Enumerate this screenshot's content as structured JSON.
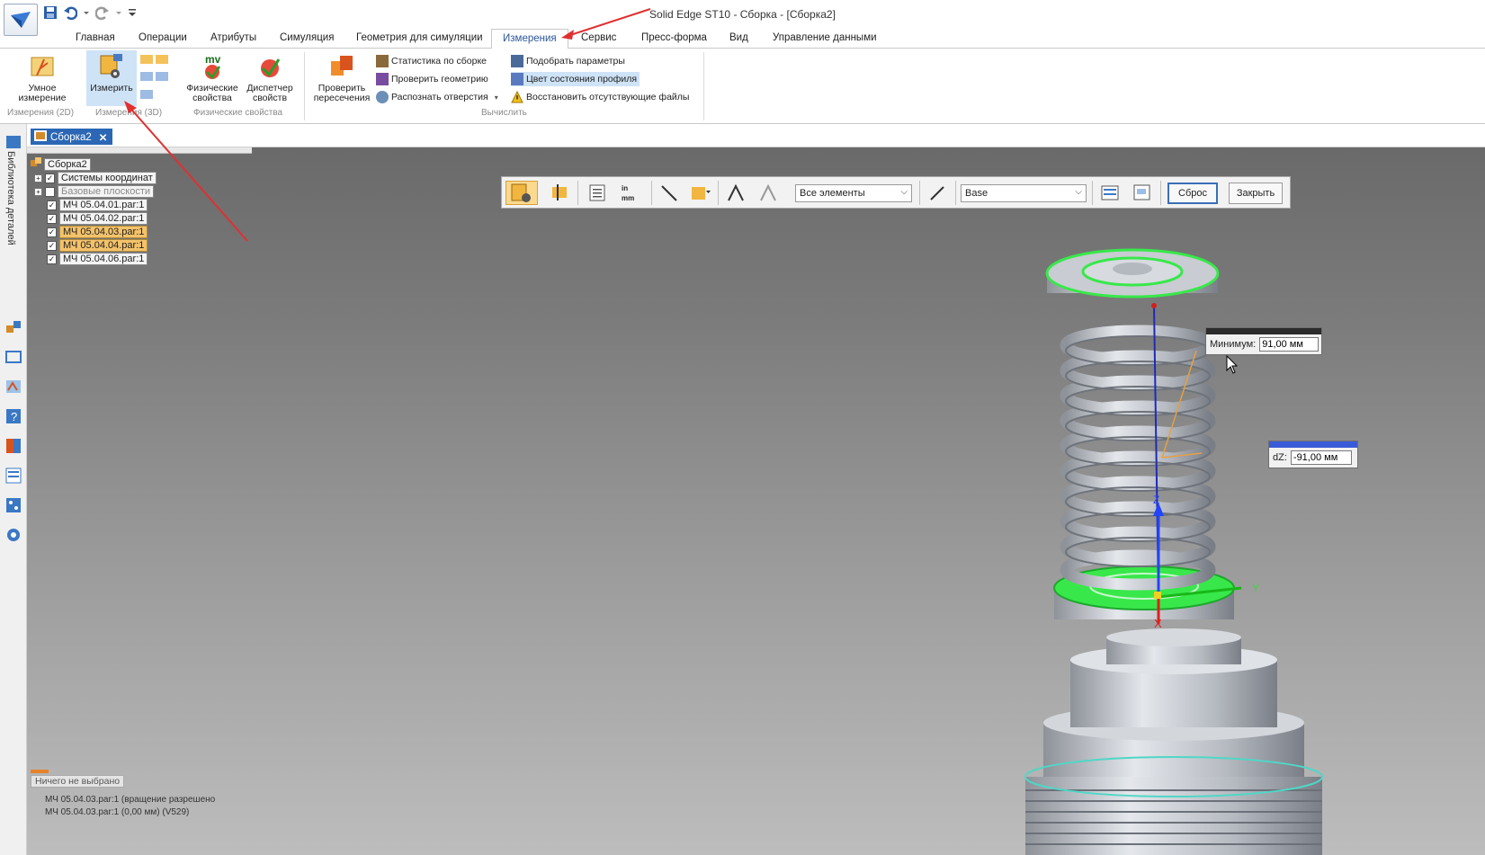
{
  "app": {
    "title": "Solid Edge ST10 - Сборка - [Сборка2]"
  },
  "tabs": [
    "Главная",
    "Операции",
    "Атрибуты",
    "Симуляция",
    "Геометрия для симуляции",
    "Измерения",
    "Сервис",
    "Пресс-форма",
    "Вид",
    "Управление данными"
  ],
  "active_tab": "Измерения",
  "ribbon": {
    "smart_measure": "Умное измерение",
    "measure": "Измерить",
    "physical_props": "Физические свойства",
    "prop_manager": "Диспетчер свойств",
    "check_interference": "Проверить пересечения",
    "assembly_stats": "Статистика по сборке",
    "check_geometry": "Проверить геометрию",
    "recognize_holes": "Распознать отверстия",
    "fit_params": "Подобрать параметры",
    "profile_color": "Цвет состояния профиля",
    "restore_files": "Восстановить отсутствующие файлы",
    "groups": {
      "measure2d": "Измерения (2D)",
      "measure3d": "Измерения (3D)",
      "physical": "Физические свойства",
      "compute": "Вычислить"
    },
    "mv_glyph": "mv"
  },
  "sidebar": {
    "library_label": "Библиотека деталей"
  },
  "document": {
    "tab_label": "Сборка2"
  },
  "tree": {
    "root": "Сборка2",
    "coord_systems": "Системы координат",
    "base_planes": "Базовые плоскости",
    "parts": [
      {
        "label": "МЧ 05.04.01.par:1",
        "selected": false
      },
      {
        "label": "МЧ 05.04.02.par:1",
        "selected": false
      },
      {
        "label": "МЧ 05.04.03.par:1",
        "selected": true
      },
      {
        "label": "МЧ 05.04.04.par:1",
        "selected": true
      },
      {
        "label": "МЧ 05.04.06.par:1",
        "selected": false
      }
    ]
  },
  "measure_bar": {
    "filter": "Все элементы",
    "coord": "Base",
    "reset": "Сброс",
    "close": "Закрыть",
    "units_glyph": "in mm"
  },
  "measurement": {
    "min_label": "Минимум:",
    "min_value": "91,00 мм",
    "dz_label": "dZ:",
    "dz_value": "-91,00 мм"
  },
  "axes": {
    "x": "X",
    "y": "Y",
    "z": "Z"
  },
  "status": {
    "nothing_selected": "Ничего не выбрано",
    "line1": "МЧ 05.04.03.par:1  (вращение разрешено",
    "line2": "МЧ 05.04.03.par:1  (0,00 мм)  (V529)"
  },
  "colors": {
    "accent": "#2b67b5",
    "selection": "#f3c26a",
    "highlight_green": "#38e84a"
  }
}
